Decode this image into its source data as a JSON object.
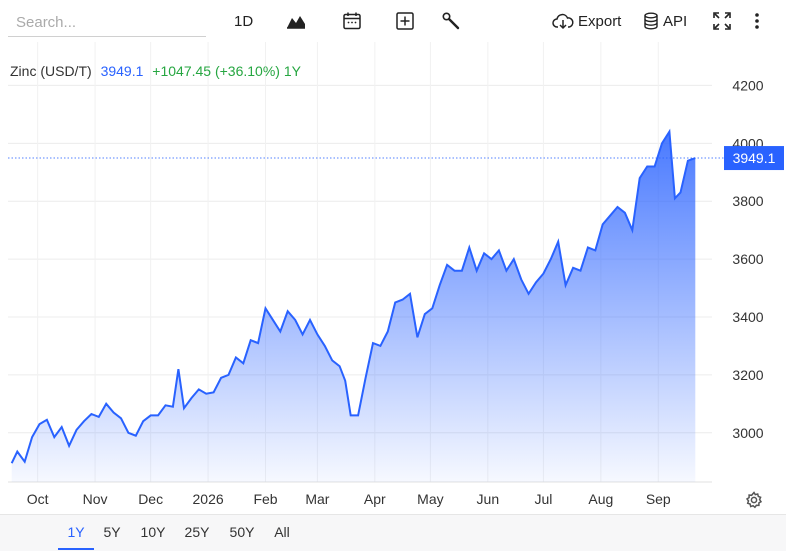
{
  "toolbar": {
    "search_placeholder": "Search...",
    "interval_label": "1D",
    "export_label": "Export",
    "api_label": "API"
  },
  "legend": {
    "name": "Zinc (USD/T)",
    "last": "3949.1",
    "change": "+1047.45 (+36.10%) 1Y",
    "last_color": "#2962ff",
    "change_color": "#26a641"
  },
  "price_tag": "3949.1",
  "accent_color": "#2962ff",
  "range_buttons": [
    "1Y",
    "5Y",
    "10Y",
    "25Y",
    "50Y",
    "All"
  ],
  "active_range": "1Y",
  "chart_data": {
    "type": "area",
    "title": "Zinc (USD/T)",
    "y_axis_side": "right",
    "ylim": [
      2830,
      4350
    ],
    "y_ticks": [
      3000,
      3200,
      3400,
      3600,
      3800,
      4000,
      4200
    ],
    "x_ticks": [
      "Oct",
      "Nov",
      "Dec",
      "2026",
      "Feb",
      "Mar",
      "Apr",
      "May",
      "Jun",
      "Jul",
      "Aug",
      "Sep"
    ],
    "x_tick_dates": [
      "2025-10-01",
      "2025-11-01",
      "2025-12-01",
      "2026-01-01",
      "2026-02-01",
      "2026-03-01",
      "2026-04-01",
      "2026-05-01",
      "2026-06-01",
      "2026-07-01",
      "2026-08-01",
      "2026-09-01"
    ],
    "last_value": 3949.1,
    "grid": true,
    "series": [
      {
        "name": "Zinc (USD/T)",
        "x": [
          "2025-09-17",
          "2025-09-20",
          "2025-09-24",
          "2025-09-28",
          "2025-10-02",
          "2025-10-06",
          "2025-10-10",
          "2025-10-14",
          "2025-10-18",
          "2025-10-22",
          "2025-10-26",
          "2025-10-30",
          "2025-11-03",
          "2025-11-07",
          "2025-11-11",
          "2025-11-15",
          "2025-11-19",
          "2025-11-23",
          "2025-11-27",
          "2025-12-01",
          "2025-12-05",
          "2025-12-09",
          "2025-12-13",
          "2025-12-16",
          "2025-12-19",
          "2025-12-23",
          "2025-12-27",
          "2025-12-31",
          "2026-01-04",
          "2026-01-08",
          "2026-01-12",
          "2026-01-16",
          "2026-01-20",
          "2026-01-24",
          "2026-01-28",
          "2026-02-01",
          "2026-02-05",
          "2026-02-09",
          "2026-02-13",
          "2026-02-17",
          "2026-02-21",
          "2026-02-25",
          "2026-03-01",
          "2026-03-05",
          "2026-03-09",
          "2026-03-13",
          "2026-03-16",
          "2026-03-19",
          "2026-03-23",
          "2026-03-27",
          "2026-03-31",
          "2026-04-04",
          "2026-04-08",
          "2026-04-12",
          "2026-04-16",
          "2026-04-20",
          "2026-04-24",
          "2026-04-28",
          "2026-05-02",
          "2026-05-06",
          "2026-05-10",
          "2026-05-14",
          "2026-05-18",
          "2026-05-22",
          "2026-05-26",
          "2026-05-30",
          "2026-06-03",
          "2026-06-07",
          "2026-06-11",
          "2026-06-15",
          "2026-06-19",
          "2026-06-23",
          "2026-06-27",
          "2026-07-01",
          "2026-07-05",
          "2026-07-09",
          "2026-07-13",
          "2026-07-17",
          "2026-07-21",
          "2026-07-25",
          "2026-07-29",
          "2026-08-02",
          "2026-08-06",
          "2026-08-10",
          "2026-08-14",
          "2026-08-18",
          "2026-08-22",
          "2026-08-26",
          "2026-08-30",
          "2026-09-03",
          "2026-09-07",
          "2026-09-10",
          "2026-09-13",
          "2026-09-17",
          "2026-09-21"
        ],
        "values": [
          2895,
          2935,
          2900,
          2985,
          3030,
          3045,
          2985,
          3020,
          2955,
          3010,
          3040,
          3065,
          3055,
          3100,
          3070,
          3050,
          3000,
          2990,
          3040,
          3060,
          3060,
          3095,
          3090,
          3220,
          3085,
          3120,
          3150,
          3135,
          3140,
          3190,
          3200,
          3260,
          3240,
          3320,
          3310,
          3430,
          3390,
          3350,
          3420,
          3390,
          3340,
          3390,
          3340,
          3300,
          3250,
          3230,
          3180,
          3060,
          3060,
          3190,
          3310,
          3300,
          3350,
          3450,
          3460,
          3480,
          3330,
          3410,
          3430,
          3510,
          3580,
          3560,
          3560,
          3640,
          3560,
          3620,
          3600,
          3630,
          3560,
          3600,
          3530,
          3480,
          3520,
          3550,
          3600,
          3660,
          3510,
          3570,
          3560,
          3640,
          3630,
          3720,
          3750,
          3780,
          3760,
          3700,
          3880,
          3920,
          3920,
          4000,
          4040,
          3810,
          3830,
          3940,
          3949.1
        ]
      }
    ]
  }
}
